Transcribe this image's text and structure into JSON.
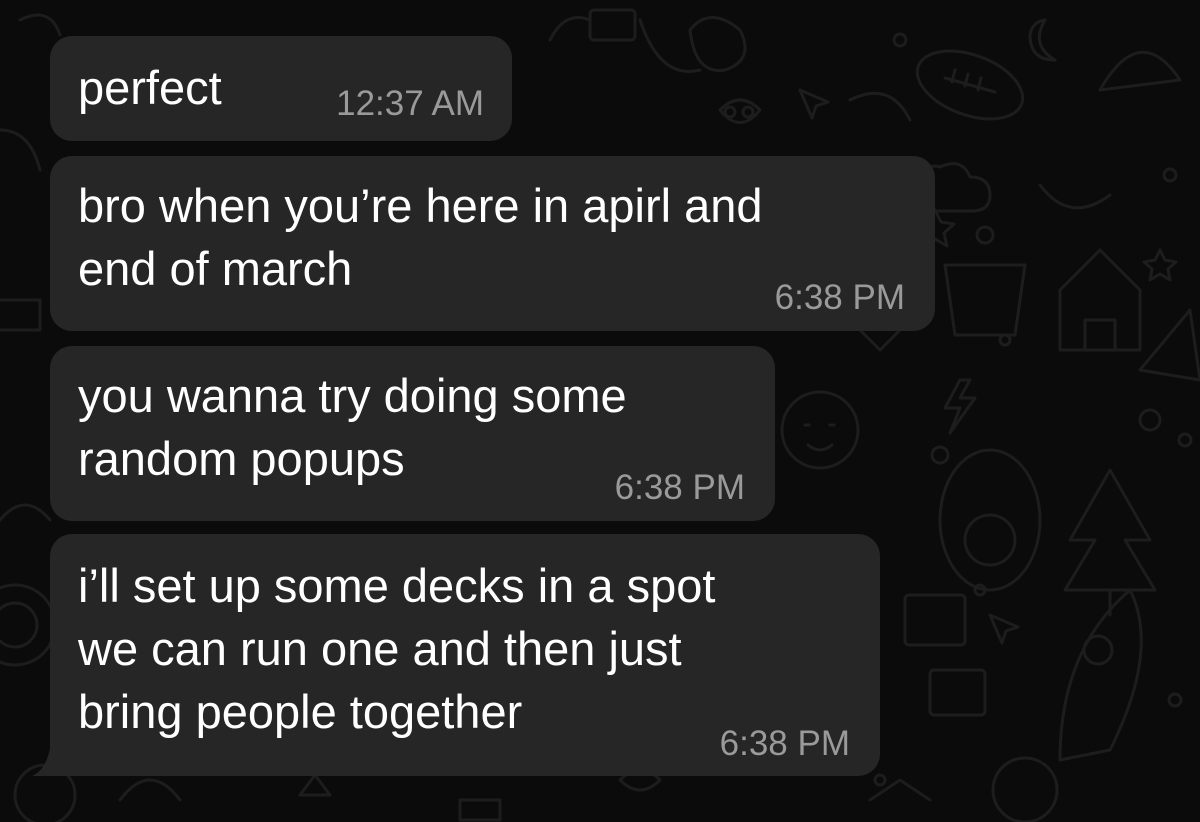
{
  "theme": {
    "background": "#0b0b0b",
    "bubble": "#262626",
    "text": "#ffffff",
    "timestamp": "#9a9a9a",
    "doodle": "#1c1c1c"
  },
  "messages": [
    {
      "text": "perfect",
      "time": "12:37 AM"
    },
    {
      "text": "bro when you’re here in apirl and\nend of march",
      "time": "6:38 PM"
    },
    {
      "text": "you wanna try doing some\nrandom popups",
      "time": "6:38 PM"
    },
    {
      "text": "i’ll set up some decks in a spot\nwe can run one and then just\nbring people together",
      "time": "6:38 PM"
    }
  ]
}
